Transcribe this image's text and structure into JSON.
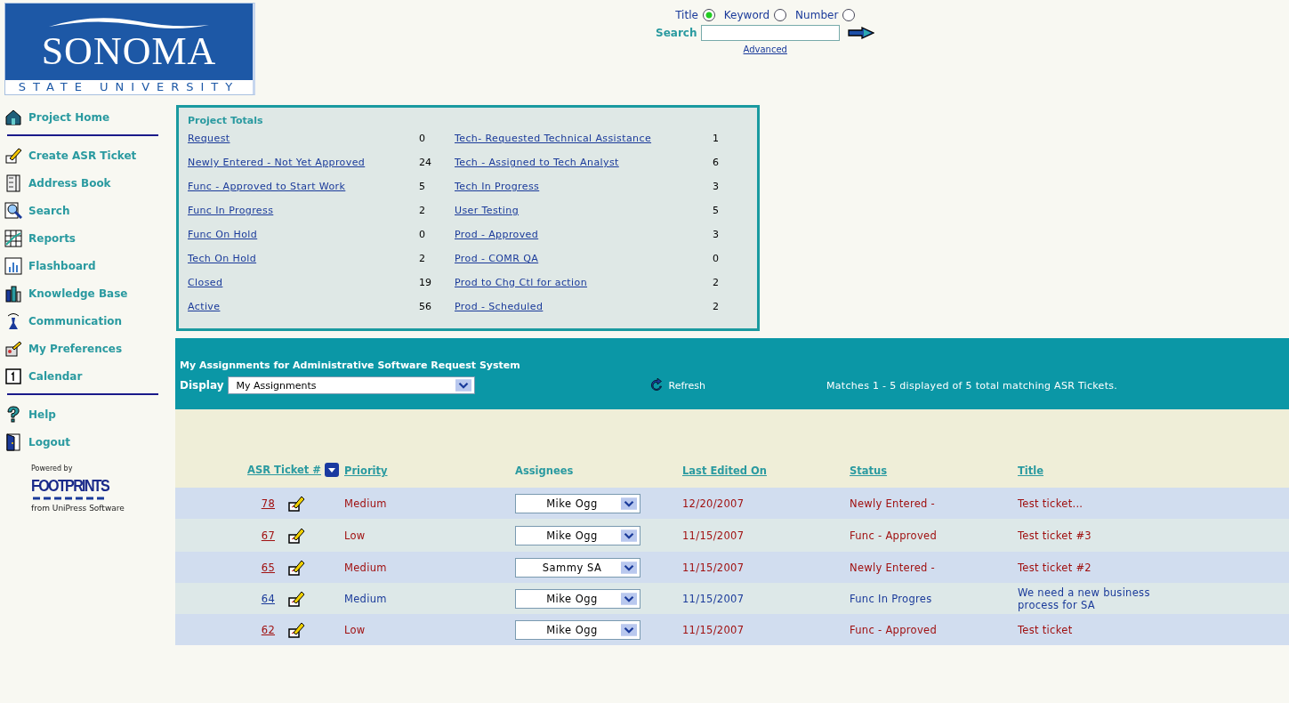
{
  "logo": {
    "name": "SONOMA",
    "subtitle": "STATE UNIVERSITY"
  },
  "search": {
    "options": [
      {
        "label": "Title",
        "selected": true
      },
      {
        "label": "Keyword",
        "selected": false
      },
      {
        "label": "Number",
        "selected": false
      }
    ],
    "label": "Search",
    "advanced": "Advanced"
  },
  "sidebar": {
    "groups": [
      [
        {
          "label": "Project Home"
        }
      ],
      [
        {
          "label": "Create ASR Ticket"
        },
        {
          "label": "Address Book"
        },
        {
          "label": "Search"
        },
        {
          "label": "Reports"
        },
        {
          "label": "Flashboard"
        },
        {
          "label": "Knowledge Base"
        },
        {
          "label": "Communication"
        },
        {
          "label": "My Preferences"
        },
        {
          "label": "Calendar"
        }
      ],
      [
        {
          "label": "Help"
        },
        {
          "label": "Logout"
        }
      ]
    ],
    "powered_by": "Powered by",
    "footprints": "FOOTPRINTS",
    "vendor": "from UniPress Software"
  },
  "project_totals": {
    "title": "Project Totals",
    "rows": [
      [
        {
          "label": "Request",
          "count": "0"
        },
        {
          "label": "Tech- Requested Technical Assistance",
          "count": "1"
        }
      ],
      [
        {
          "label": "Newly Entered - Not Yet Approved",
          "count": "24"
        },
        {
          "label": "Tech - Assigned to Tech Analyst",
          "count": "6"
        }
      ],
      [
        {
          "label": "Func - Approved to Start Work",
          "count": "5"
        },
        {
          "label": "Tech In Progress",
          "count": "3"
        }
      ],
      [
        {
          "label": "Func In Progress",
          "count": "2"
        },
        {
          "label": "User Testing",
          "count": "5"
        }
      ],
      [
        {
          "label": "Func On Hold",
          "count": "0"
        },
        {
          "label": "Prod - Approved",
          "count": "3"
        }
      ],
      [
        {
          "label": "Tech On Hold",
          "count": "2"
        },
        {
          "label": "Prod - COMR QA",
          "count": "0"
        }
      ],
      [
        {
          "label": "Closed",
          "count": "19"
        },
        {
          "label": "Prod to Chg Ctl for action",
          "count": "2"
        }
      ],
      [
        {
          "label": "Active",
          "count": "56"
        },
        {
          "label": "Prod - Scheduled",
          "count": "2"
        }
      ]
    ]
  },
  "assignments": {
    "title": "My Assignments for Administrative Software Request System",
    "display_label": "Display",
    "display_value": "My Assignments",
    "refresh": "Refresh",
    "matches": "Matches 1 - 5 displayed of 5 total matching ASR Tickets."
  },
  "table": {
    "columns": [
      "ASR Ticket #",
      "Priority",
      "Assignees",
      "Last Edited On",
      "Status",
      "Title"
    ],
    "rows": [
      {
        "ticket": "78",
        "priority": "Medium",
        "assignee": "Mike Ogg",
        "last_edited": "12/20/2007",
        "status": "Newly Entered -",
        "title": "Test ticket...",
        "color": "#a01010"
      },
      {
        "ticket": "67",
        "priority": "Low",
        "assignee": "Mike Ogg",
        "last_edited": "11/15/2007",
        "status": "Func - Approved",
        "title": "Test ticket #3",
        "color": "#a01010"
      },
      {
        "ticket": "65",
        "priority": "Medium",
        "assignee": "Sammy SA",
        "last_edited": "11/15/2007",
        "status": "Newly Entered -",
        "title": "Test ticket #2",
        "color": "#a01010"
      },
      {
        "ticket": "64",
        "priority": "Medium",
        "assignee": "Mike Ogg",
        "last_edited": "11/15/2007",
        "status": "Func In Progres",
        "title": "We need a new business process for SA",
        "color": "#1a3a9a"
      },
      {
        "ticket": "62",
        "priority": "Low",
        "assignee": "Mike Ogg",
        "last_edited": "11/15/2007",
        "status": "Func - Approved",
        "title": "Test ticket",
        "color": "#a01010"
      }
    ]
  }
}
